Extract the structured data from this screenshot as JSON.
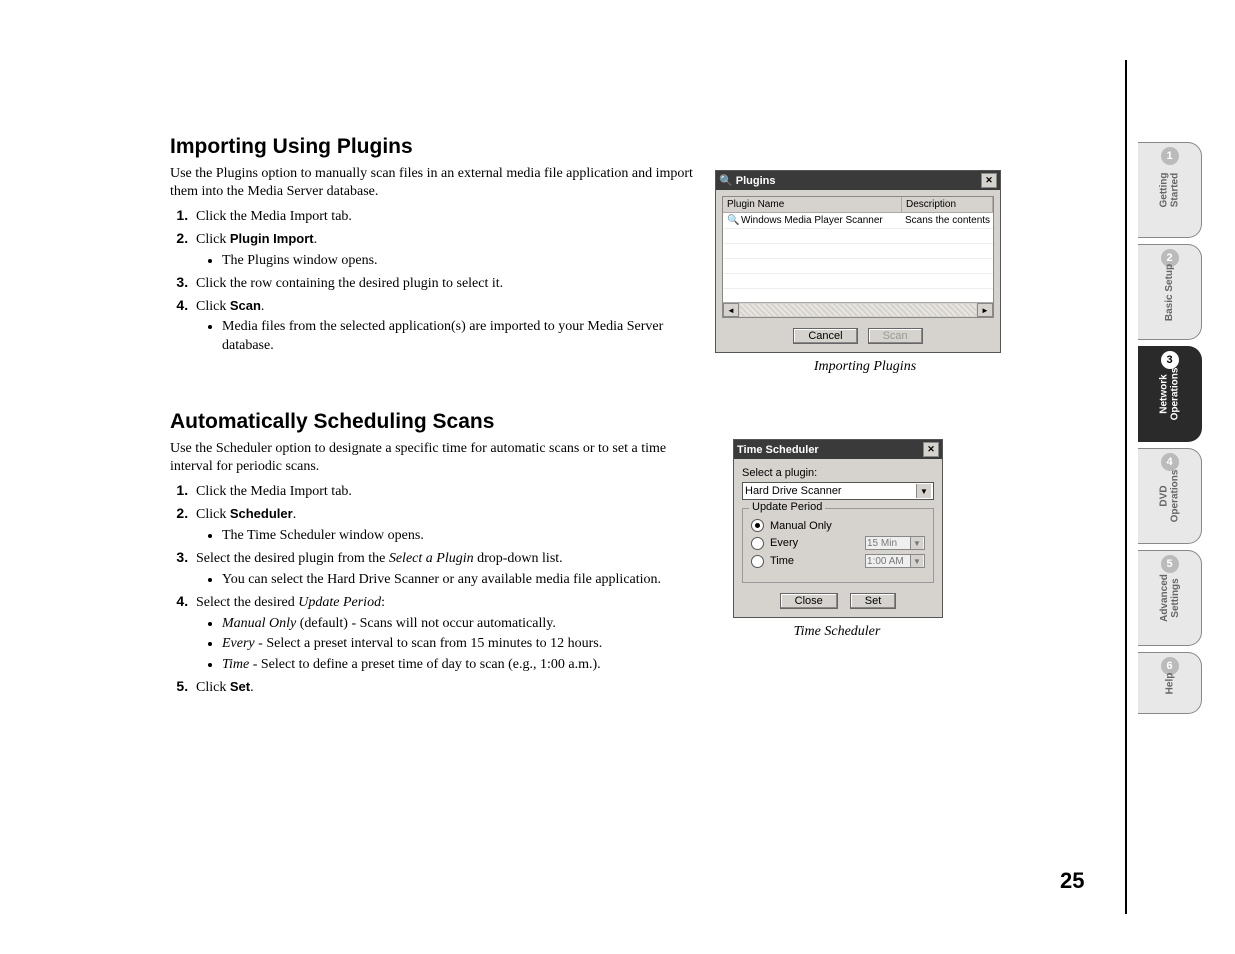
{
  "page_number": "25",
  "section1": {
    "heading": "Importing Using Plugins",
    "intro": "Use the Plugins option to manually scan files in an external media file application and import them into the Media Server database.",
    "steps": [
      "Click the Media Import tab.",
      "Click ",
      "Click the row containing the desired plugin to select it.",
      "Click "
    ],
    "step2_bold": "Plugin Import",
    "step2_sub": "The Plugins window opens.",
    "step4_bold": "Scan",
    "step4_sub": "Media files from the selected application(s) are imported to your Media Server database."
  },
  "plugins_dialog": {
    "title": "Plugins",
    "col1": "Plugin Name",
    "col2": "Description",
    "row_name": "Windows Media Player Scanner",
    "row_desc": "Scans the contents of Window",
    "btn_cancel": "Cancel",
    "btn_scan": "Scan",
    "caption": "Importing Plugins"
  },
  "section2": {
    "heading": "Automatically Scheduling Scans",
    "intro": "Use the Scheduler option to designate a specific time for automatic scans or to set a time interval for periodic scans.",
    "step1": "Click the Media Import tab.",
    "step2_pre": "Click ",
    "step2_bold": "Scheduler",
    "step2_sub": "The Time Scheduler window opens.",
    "step3_pre": "Select the desired plugin from the ",
    "step3_italic": "Select a Plugin",
    "step3_post": " drop-down list.",
    "step3_sub": "You can select the Hard Drive Scanner or any available media file application.",
    "step4_pre": "Select the desired ",
    "step4_italic": "Update Period",
    "step4_post": ":",
    "opt1_label": "Manual Only",
    "opt1_rest": " (default) - Scans will not occur automatically.",
    "opt2_label": "Every",
    "opt2_rest": " - Select a preset interval to scan from 15 minutes to 12 hours.",
    "opt3_label": "Time",
    "opt3_rest": " - Select to define a preset time of day to scan (e.g., 1:00 a.m.).",
    "step5_pre": "Click ",
    "step5_bold": "Set"
  },
  "ts_dialog": {
    "title": "Time Scheduler",
    "select_label": "Select a plugin:",
    "select_value": "Hard Drive Scanner",
    "legend": "Update Period",
    "r1": "Manual Only",
    "r2": "Every",
    "r2_val": "15 Min",
    "r3": "Time",
    "r3_val": "1:00 AM",
    "btn_close": "Close",
    "btn_set": "Set",
    "caption": "Time Scheduler"
  },
  "tabs": [
    {
      "n": "1",
      "label": "Getting\nStarted"
    },
    {
      "n": "2",
      "label": "Basic Setup"
    },
    {
      "n": "3",
      "label": "Network\nOperations"
    },
    {
      "n": "4",
      "label": "DVD\nOperations"
    },
    {
      "n": "5",
      "label": "Advanced\nSettings"
    },
    {
      "n": "6",
      "label": "Help"
    }
  ]
}
